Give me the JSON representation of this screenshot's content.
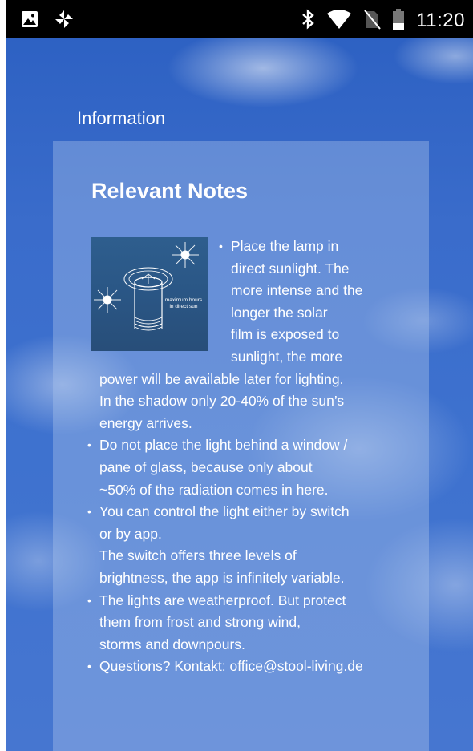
{
  "status_bar": {
    "left_icons": [
      "image-icon",
      "pinwheel-icon"
    ],
    "right_icons": [
      "bluetooth-icon",
      "wifi-icon",
      "no-sim-icon",
      "battery-icon"
    ],
    "time": "11:20"
  },
  "page": {
    "title": "Information"
  },
  "panel": {
    "heading": "Relevant Notes",
    "image": {
      "label_line1": "maximum hours",
      "label_line2": "in direct sun"
    },
    "notes": [
      {
        "lines": [
          "Place the lamp in",
          "direct sunlight. The",
          "more intense and the",
          "longer the solar",
          "film is exposed to",
          "sunlight, the more",
          "power will be available later for lighting.",
          "In the shadow only 20-40% of the sun’s",
          "energy arrives."
        ]
      },
      {
        "lines": [
          "Do not place the light behind a window /",
          "pane of glass, because only about",
          "~50% of the radiation comes in here."
        ]
      },
      {
        "lines": [
          "You can control the light either by switch",
          "or by app.",
          "The switch offers three levels of",
          "brightness, the app is infinitely variable."
        ]
      },
      {
        "lines": [
          "The lights are weatherproof. But protect",
          "them from frost and strong wind,",
          "storms and downpours."
        ]
      },
      {
        "lines": [
          "Questions? Kontakt: office@stool-living.de"
        ]
      }
    ]
  }
}
